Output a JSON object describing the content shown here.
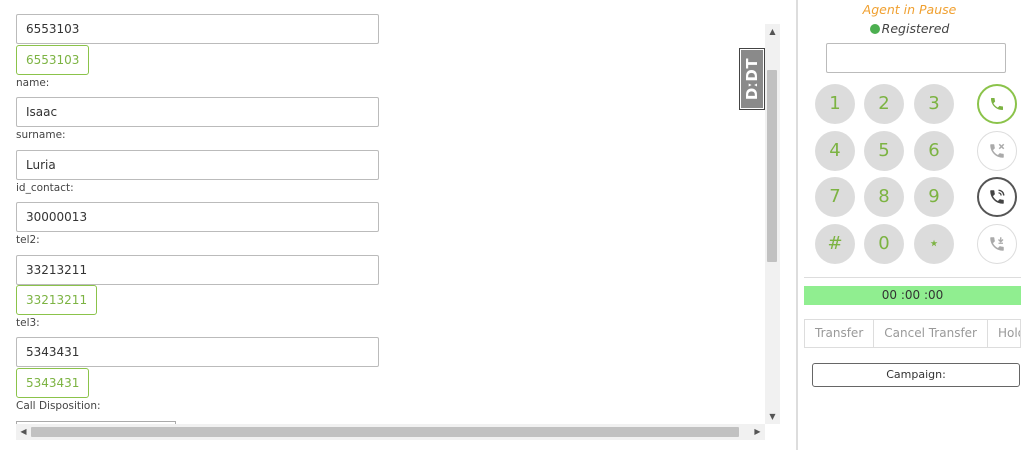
{
  "form": {
    "tel1_value": "6553103",
    "tel1_button": "6553103",
    "name_label": "name:",
    "name_value": "Isaac",
    "surname_label": "surname:",
    "surname_value": "Luria",
    "id_contact_label": "id_contact:",
    "id_contact_value": "30000013",
    "tel2_label": "tel2:",
    "tel2_value": "33213211",
    "tel2_button": "33213211",
    "tel3_label": "tel3:",
    "tel3_value": "5343431",
    "tel3_button": "5343431",
    "disposition_label": "Call Disposition:"
  },
  "badge": {
    "text": "DːDT"
  },
  "phone": {
    "agent_status": "Agent in Pause",
    "registration": "Registered",
    "dial_value": "",
    "keys": [
      "1",
      "2",
      "3",
      "4",
      "5",
      "6",
      "7",
      "8",
      "9",
      "#",
      "0",
      "⋆"
    ],
    "actions": [
      "call-icon",
      "hangup-icon",
      "phone-transfer-icon",
      "phone-hold-icon"
    ],
    "timer": "00 :00 :00",
    "transfer_buttons": [
      "Transfer",
      "Cancel Transfer",
      "Hold"
    ],
    "campaign_label": "Campaign:"
  },
  "colors": {
    "accent": "#7cb342",
    "status_pause": "#f0a030",
    "timer_bg": "#90ee90",
    "registered_dot": "#4caf50"
  }
}
